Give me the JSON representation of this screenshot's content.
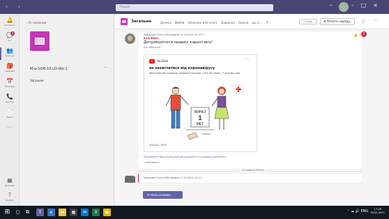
{
  "app": {
    "search_placeholder": "Пошук",
    "window_controls": [
      "–",
      "□",
      "×"
    ],
    "nav_arrows": "‹ ›"
  },
  "rail": {
    "items": [
      {
        "label": "Активність",
        "icon": "bell-icon",
        "glyph": "🔔"
      },
      {
        "label": "Чат",
        "icon": "chat-icon",
        "glyph": "💬",
        "badge": "3"
      },
      {
        "label": "Команди",
        "icon": "teams-icon",
        "glyph": "👥",
        "active": true
      },
      {
        "label": "Завдання",
        "icon": "assignments-icon",
        "glyph": "🎒"
      },
      {
        "label": "Календар",
        "icon": "calendar-icon",
        "glyph": "📅"
      },
      {
        "label": "Виклики",
        "icon": "phone-icon",
        "glyph": "📞"
      },
      {
        "label": "Файли",
        "icon": "files-icon",
        "glyph": "📄"
      },
      {
        "label": "",
        "icon": "more-apps-icon",
        "glyph": "···"
      }
    ],
    "bottom": [
      {
        "label": "Програми",
        "icon": "apps-icon",
        "glyph": "▦"
      },
      {
        "label": "Довідка",
        "icon": "help-icon",
        "glyph": "?"
      }
    ]
  },
  "team_panel": {
    "back_label": "‹  Усі команди",
    "team_name": "М-а-10/6-10-LD-Ukr.1",
    "more": "···",
    "channel": "Загальне"
  },
  "header": {
    "title": "Загальне",
    "tabs": [
      "Дописи",
      "Файли",
      "Записник для класу",
      "Завдання",
      "Оцінки",
      "ще 2 ⌄"
    ],
    "add_tab": "+",
    "pill_label": "Огляд",
    "meet_label": "⊕ Почати нараду",
    "info": "ⓘ",
    "more": "···"
  },
  "post": {
    "author_line": "Завідувач Ольга Вікторівна  11.10.2020 12:19  ✎",
    "importance": "ВАЖЛИВО!",
    "subject": "Дотримуйтеся правил карантину!",
    "subline": "Ще зміниться",
    "like": "👍 1",
    "alert": "!",
    "card": {
      "source_name": "YouTube",
      "more": "···",
      "title": "як захиститися від коронавірусу",
      "description": "Міністерство охорони здоров'я України | 232.5K views | 7 months ago",
      "source": "YouTube | MOZ",
      "sign_word": "ВИРАЗ",
      "sign_number": "1",
      "sign_unit": "МЕТ"
    },
    "link_text": "Посилання: https://www.youtube.com/watch?v=правила-карантину",
    "reply": "↩ Відповісти"
  },
  "date_separator": "11 жовтня 2020 р.",
  "post2": {
    "author_line": "Завідувач Ольга Вікторівна  11.10.2020 13:11"
  },
  "new_conversation": "☰  Нова розмова",
  "taskbar": {
    "start": "⊞",
    "search": "○",
    "task_view": "⧉",
    "apps": [
      {
        "icon": "teams-taskbar-icon",
        "color": "#6264a7",
        "glyph": "T"
      },
      {
        "icon": "edge-taskbar-icon",
        "color": "#3277bc",
        "glyph": "e"
      },
      {
        "icon": "explorer-taskbar-icon",
        "color": "#f3c23e",
        "glyph": "▬"
      },
      {
        "icon": "store-taskbar-icon",
        "color": "#3c3c3c",
        "glyph": "▦"
      },
      {
        "icon": "mail-taskbar-icon",
        "color": "#0078d4",
        "glyph": "✉"
      },
      {
        "icon": "excel-taskbar-icon",
        "color": "#217346",
        "glyph": "X"
      },
      {
        "icon": "chrome-taskbar-icon",
        "color": "#e8b600",
        "glyph": "●"
      }
    ],
    "tray_icons": "⌃ ☁ 🔊 ENG",
    "time": "17:26",
    "date": "30.01.2021"
  },
  "colors": {
    "titlebar": "#464775",
    "accent": "#6264a7",
    "important": "#c4314b"
  }
}
